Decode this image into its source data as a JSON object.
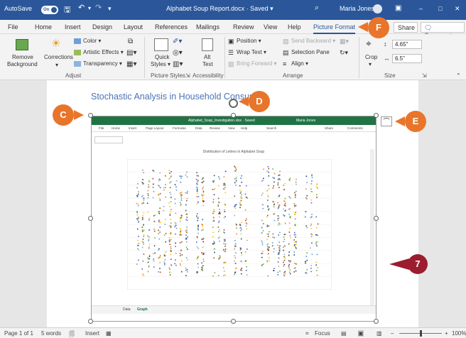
{
  "titlebar": {
    "autosave_label": "AutoSave",
    "autosave_state": "On",
    "document_title": "Alphabet Soup Report.docx · Saved ▾",
    "user_name": "Maria Jones"
  },
  "tabs": [
    "File",
    "Home",
    "Insert",
    "Design",
    "Layout",
    "References",
    "Mailings",
    "Review",
    "View",
    "Help",
    "Picture Format"
  ],
  "share_label": "Share",
  "comments_label": "Comments",
  "ribbon": {
    "remove_background": [
      "Remove",
      "Background"
    ],
    "corrections": "Corrections",
    "color": "Color ▾",
    "artistic_effects": "Artistic Effects ▾",
    "transparency": "Transparency ▾",
    "adjust_label": "Adjust",
    "quick_styles": [
      "Quick",
      "Styles ▾"
    ],
    "picture_styles_label": "Picture Styles",
    "alt_text": [
      "Alt",
      "Text"
    ],
    "accessibility_label": "Accessibility",
    "position": "Position ▾",
    "wrap_text": "Wrap Text ▾",
    "bring_forward": "Bring Forward ▾",
    "send_backward": "Send Backward ▾",
    "selection_pane": "Selection Pane",
    "align": "Align ▾",
    "arrange_label": "Arrange",
    "crop": "Crop",
    "height": "4.65\"",
    "width": "6.5\"",
    "size_label": "Size"
  },
  "document": {
    "heading": "Stochastic Analysis in Household Consum"
  },
  "embedded": {
    "title": "Alphabet_Soup_Investigation.xlsx · Saved",
    "user": "Maria Jones",
    "tabs": [
      "File",
      "Home",
      "Insert",
      "Page Layout",
      "Formulas",
      "Data",
      "Review",
      "View",
      "Help",
      "Search"
    ],
    "share": "Share",
    "comments": "Comments",
    "chart_title": "Distribution of Letters in Alphabet Soup",
    "sheet_tabs": [
      "Data",
      "Graph"
    ]
  },
  "callouts": {
    "c": "C",
    "d": "D",
    "e": "E",
    "f": "F",
    "seven": "7"
  },
  "status": {
    "page": "Page 1 of 1",
    "words": "5 words",
    "insert": "Insert",
    "focus": "Focus",
    "zoom": "100%"
  },
  "colors": {
    "word_blue": "#2b579a",
    "excel_green": "#217346",
    "callout_orange": "#e8752a",
    "callout_red": "#9b1d2e"
  }
}
